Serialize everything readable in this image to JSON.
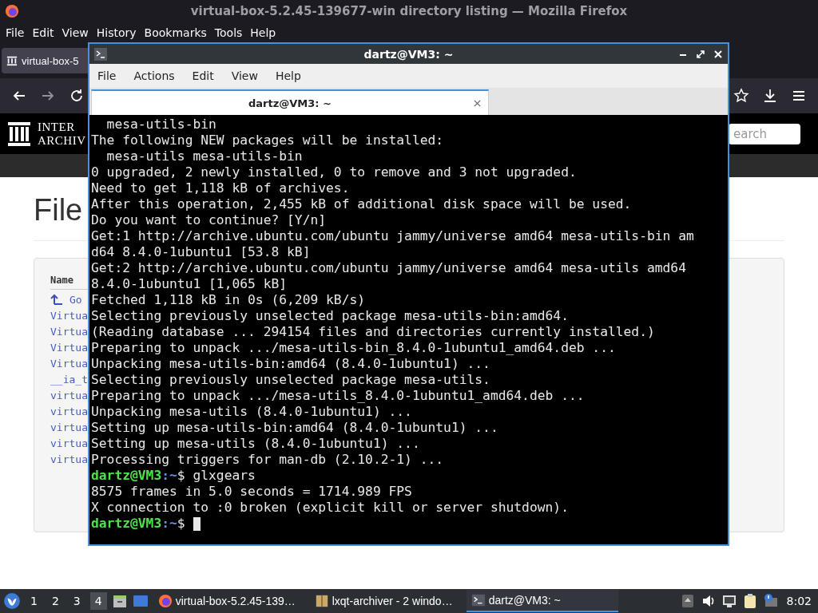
{
  "browser": {
    "title": "virtual-box-5.2.45-139677-win directory listing — Mozilla Firefox",
    "menu": [
      "File",
      "Edit",
      "View",
      "History",
      "Bookmarks",
      "Tools",
      "Help"
    ],
    "tab": {
      "label": "virtual-box-5"
    },
    "site": {
      "logo_top": "INTER",
      "logo_bottom": "ARCHIV",
      "search_placeholder": "earch"
    },
    "heading": "File",
    "table": {
      "column": "Name",
      "rows": [
        {
          "kind": "up",
          "label": "Go"
        },
        {
          "kind": "file",
          "label": "Virtua"
        },
        {
          "kind": "file",
          "label": "Virtua"
        },
        {
          "kind": "file",
          "label": "Virtua"
        },
        {
          "kind": "file",
          "label": "Virtua"
        },
        {
          "kind": "file",
          "label": "__ia_t"
        },
        {
          "kind": "file",
          "label": "virtua"
        },
        {
          "kind": "file",
          "label": "virtua"
        },
        {
          "kind": "file",
          "label": "virtua"
        },
        {
          "kind": "file",
          "label": "virtua"
        },
        {
          "kind": "file",
          "label": "virtua"
        }
      ]
    }
  },
  "terminal": {
    "title": "dartz@VM3: ~",
    "menu": [
      "File",
      "Actions",
      "Edit",
      "View",
      "Help"
    ],
    "tab": "dartz@VM3: ~",
    "lines": [
      {
        "kind": "output",
        "text": "  mesa-utils-bin"
      },
      {
        "kind": "output",
        "text": "The following NEW packages will be installed:"
      },
      {
        "kind": "output",
        "text": "  mesa-utils mesa-utils-bin"
      },
      {
        "kind": "output",
        "text": "0 upgraded, 2 newly installed, 0 to remove and 3 not upgraded."
      },
      {
        "kind": "output",
        "text": "Need to get 1,118 kB of archives."
      },
      {
        "kind": "output",
        "text": "After this operation, 2,455 kB of additional disk space will be used."
      },
      {
        "kind": "output",
        "text": "Do you want to continue? [Y/n]"
      },
      {
        "kind": "output",
        "text": "Get:1 http://archive.ubuntu.com/ubuntu jammy/universe amd64 mesa-utils-bin am"
      },
      {
        "kind": "output",
        "text": "d64 8.4.0-1ubuntu1 [53.8 kB]"
      },
      {
        "kind": "output",
        "text": "Get:2 http://archive.ubuntu.com/ubuntu jammy/universe amd64 mesa-utils amd64"
      },
      {
        "kind": "output",
        "text": "8.4.0-1ubuntu1 [1,065 kB]"
      },
      {
        "kind": "output",
        "text": "Fetched 1,118 kB in 0s (6,209 kB/s)"
      },
      {
        "kind": "output",
        "text": "Selecting previously unselected package mesa-utils-bin:amd64."
      },
      {
        "kind": "output",
        "text": "(Reading database ... 294154 files and directories currently installed.)"
      },
      {
        "kind": "output",
        "text": "Preparing to unpack .../mesa-utils-bin_8.4.0-1ubuntu1_amd64.deb ..."
      },
      {
        "kind": "output",
        "text": "Unpacking mesa-utils-bin:amd64 (8.4.0-1ubuntu1) ..."
      },
      {
        "kind": "output",
        "text": "Selecting previously unselected package mesa-utils."
      },
      {
        "kind": "output",
        "text": "Preparing to unpack .../mesa-utils_8.4.0-1ubuntu1_amd64.deb ..."
      },
      {
        "kind": "output",
        "text": "Unpacking mesa-utils (8.4.0-1ubuntu1) ..."
      },
      {
        "kind": "output",
        "text": "Setting up mesa-utils-bin:amd64 (8.4.0-1ubuntu1) ..."
      },
      {
        "kind": "output",
        "text": "Setting up mesa-utils (8.4.0-1ubuntu1) ..."
      },
      {
        "kind": "output",
        "text": "Processing triggers for man-db (2.10.2-1) ..."
      },
      {
        "kind": "prompt",
        "user": "dartz@VM3",
        "path": ":~",
        "command": "$ glxgears"
      },
      {
        "kind": "output",
        "text": "8575 frames in 5.0 seconds = 1714.989 FPS"
      },
      {
        "kind": "output",
        "text": "X connection to :0 broken (explicit kill or server shutdown)."
      },
      {
        "kind": "prompt",
        "user": "dartz@VM3",
        "path": ":~",
        "command": "$",
        "cursor": true
      }
    ]
  },
  "taskbar": {
    "workspaces": [
      {
        "label": "1",
        "selected": false
      },
      {
        "label": "2",
        "selected": false
      },
      {
        "label": "3",
        "selected": false
      },
      {
        "label": "4",
        "selected": true
      }
    ],
    "tasks": [
      {
        "kind": "firefox",
        "label": "virtual-box-5.2.45-139…",
        "selected": false
      },
      {
        "kind": "archiver",
        "label": "lxqt-archiver - 2 windo…",
        "selected": false
      },
      {
        "kind": "terminal",
        "label": "dartz@VM3: ~",
        "selected": true
      }
    ],
    "clock": "8:02"
  }
}
